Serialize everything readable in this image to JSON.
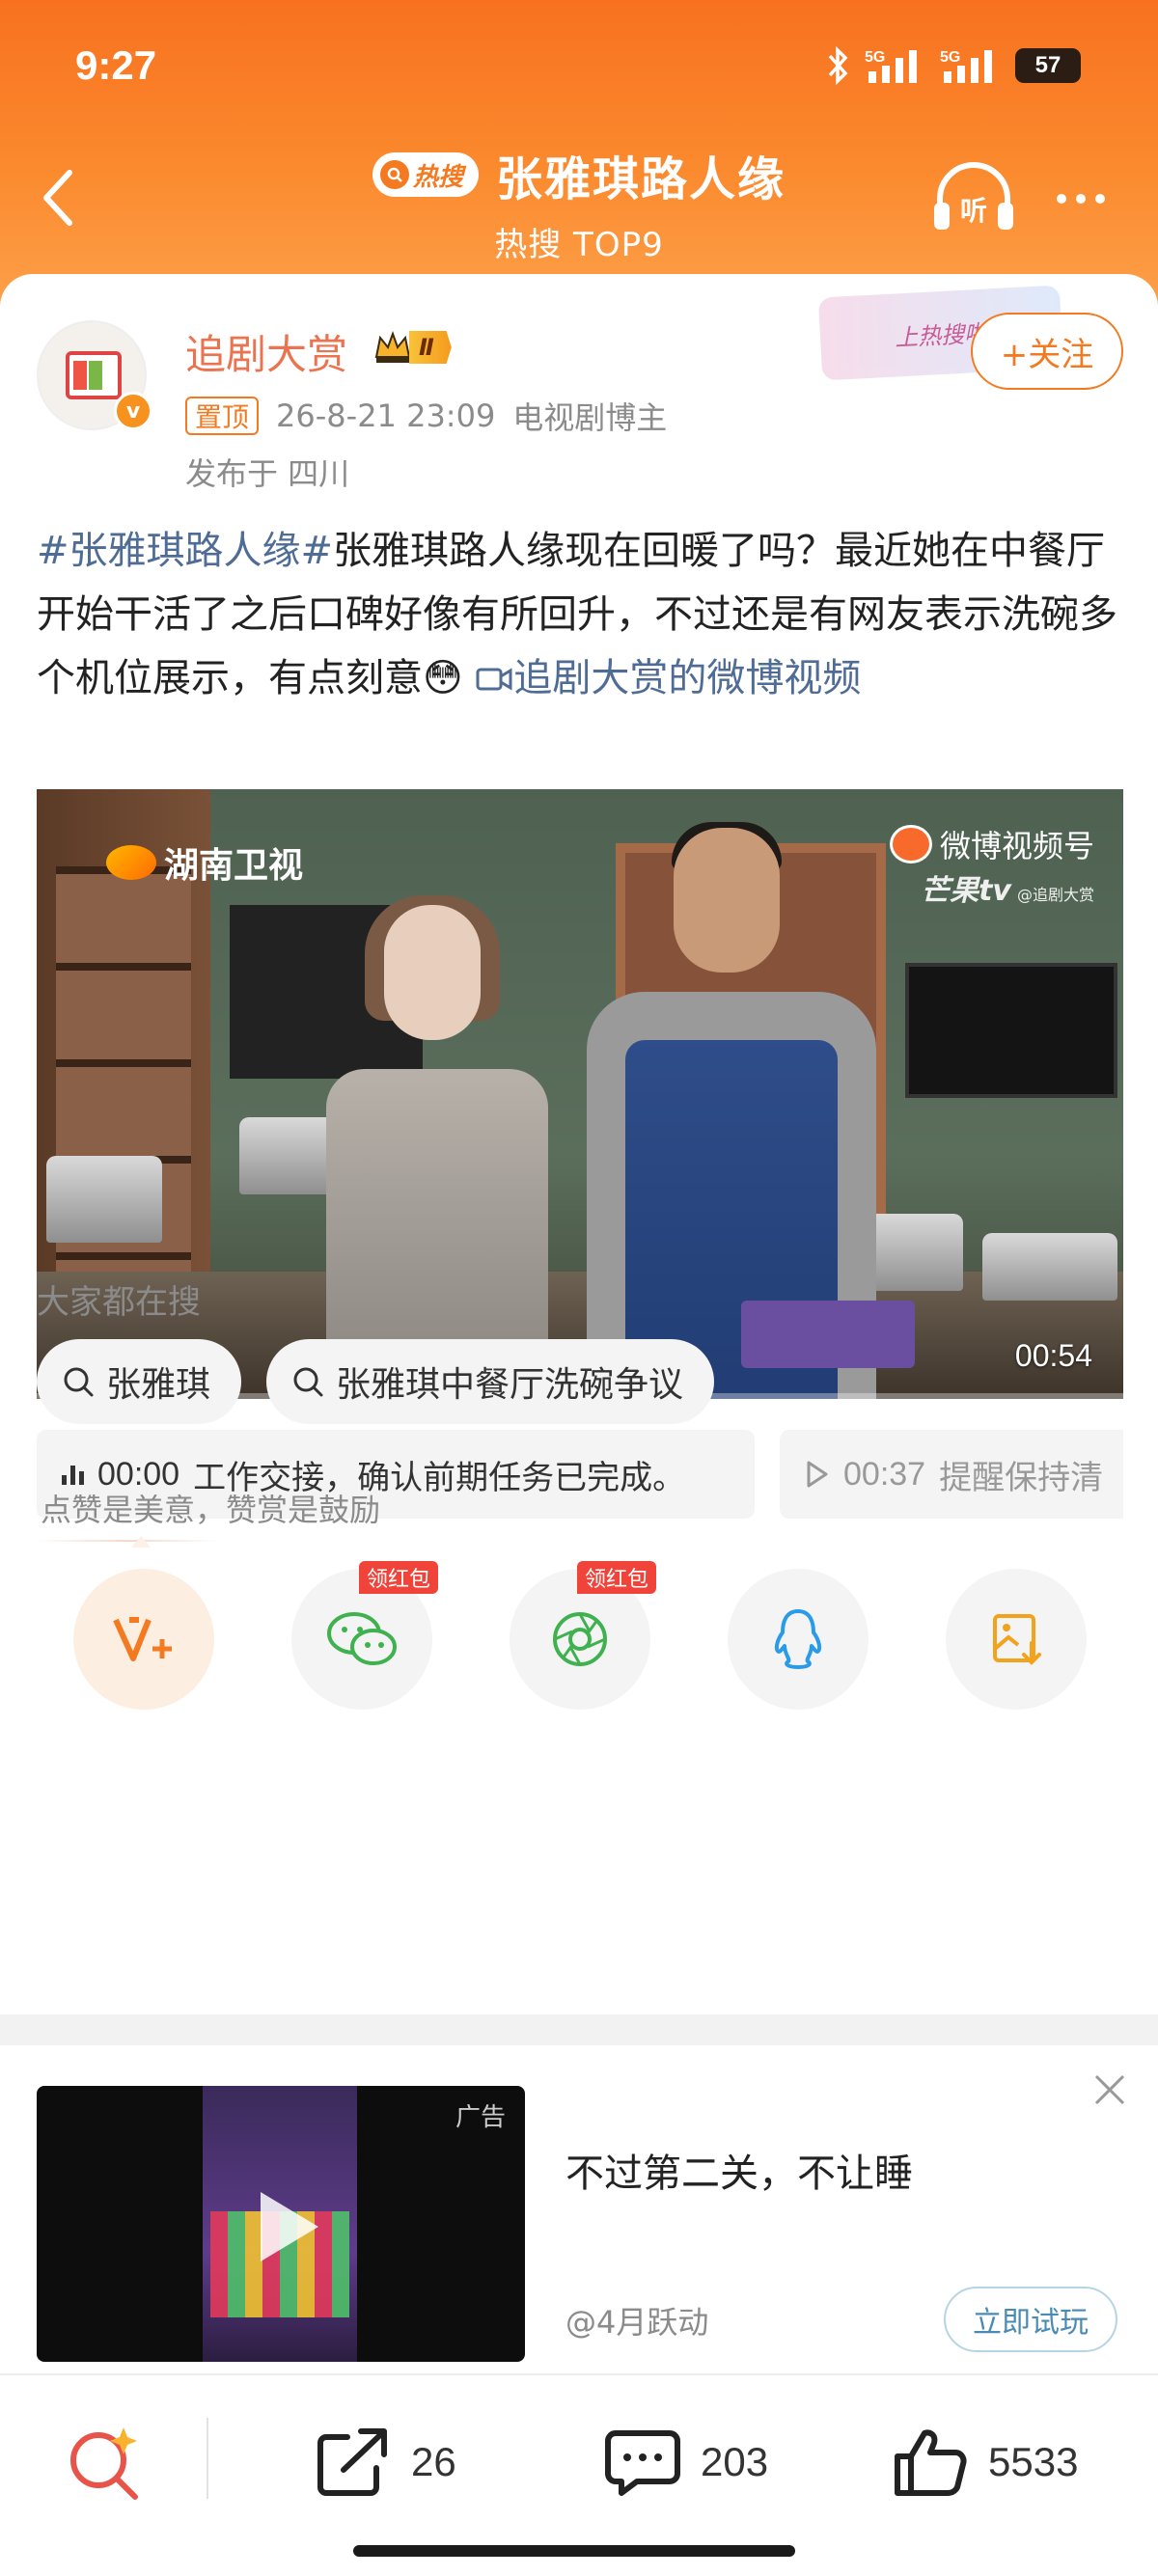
{
  "status_bar": {
    "time": "9:27",
    "signal1": "5G",
    "signal2": "5G",
    "battery": "57"
  },
  "nav": {
    "hot_tag": "热搜",
    "title": "张雅琪路人缘",
    "subtitle": "热搜 TOP9",
    "listen_label": "听"
  },
  "post": {
    "author": "追剧大赏",
    "vip_level": "Ⅱ",
    "verified_mark": "v",
    "hot_banner": "上热搜啦",
    "follow_label": "+关注",
    "pin_tag": "置顶",
    "time": "26-8-21 23:09",
    "author_role": "电视剧博主",
    "location": "发布于 四川",
    "topic": "#张雅琪路人缘#",
    "body": "张雅琪路人缘现在回暖了吗？最近她在中餐厅开始干活了之后口碑好像有所回升，不过还是有网友表示洗碗多个机位展示，有点刻意",
    "emoji": "😳",
    "video_link": "追剧大赏的微博视频"
  },
  "video": {
    "channel_logo": "湖南卫视",
    "platform_logo": "微博视频号",
    "platform_logo2": "芒果tv",
    "uploader_mark": "@追剧大赏",
    "duration": "00:54",
    "progress": 0
  },
  "chapters": [
    {
      "time": "00:00",
      "text": "工作交接，确认前期任务已完成。"
    },
    {
      "time": "00:37",
      "text": "提醒保持清"
    }
  ],
  "search": {
    "heading": "大家都在搜",
    "chips": [
      "张雅琪",
      "张雅琪中餐厅洗碗争议"
    ]
  },
  "reward": {
    "text": "点赞是美意，赞赏是鼓励",
    "red_packet_label": "领红包"
  },
  "share_icons": [
    "reward-v-icon",
    "wechat-icon",
    "moments-icon",
    "qq-icon",
    "save-image-icon"
  ],
  "ad": {
    "label": "广告",
    "title": "不过第二关，不让睡",
    "source": "@4月跃动",
    "cta": "立即试玩"
  },
  "bottom_bar": {
    "repost_count": "26",
    "comment_count": "203",
    "like_count": "5533"
  },
  "colors": {
    "header_orange": "#f8711f",
    "accent_orange": "#f37a20",
    "link_blue": "#4f6c96",
    "author_name": "#eb7350"
  }
}
